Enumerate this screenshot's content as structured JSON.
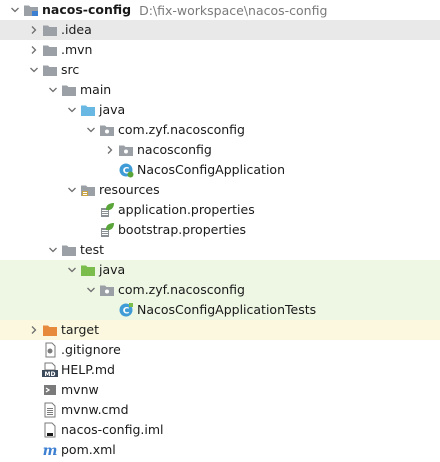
{
  "colors": {
    "folder": "#9aa0a6",
    "folder_source": "#69b8e3",
    "folder_test": "#7bbd4d",
    "folder_excluded": "#e88a3c",
    "resources_badge": "#c9a33f",
    "class_icon": "#3f9cd6",
    "spring_leaf": "#5aa53a",
    "selection_grey": "#e9e9e9",
    "selection_green": "#eef6e4",
    "selection_yellow": "#fbf8df"
  },
  "tree": [
    {
      "label": "nacos-config",
      "path": "D:\\fix-workspace\\nacos-config",
      "level": 0,
      "expander": "down",
      "icon": "module-folder-icon",
      "bold": true
    },
    {
      "label": ".idea",
      "level": 1,
      "expander": "right",
      "icon": "folder-icon",
      "highlight": "grey"
    },
    {
      "label": ".mvn",
      "level": 1,
      "expander": "right",
      "icon": "folder-icon"
    },
    {
      "label": "src",
      "level": 1,
      "expander": "down",
      "icon": "folder-icon"
    },
    {
      "label": "main",
      "level": 2,
      "expander": "down",
      "icon": "folder-icon"
    },
    {
      "label": "java",
      "level": 3,
      "expander": "down",
      "icon": "source-folder-icon"
    },
    {
      "label": "com.zyf.nacosconfig",
      "level": 4,
      "expander": "down",
      "icon": "package-icon"
    },
    {
      "label": "nacosconfig",
      "level": 5,
      "expander": "right",
      "icon": "package-icon"
    },
    {
      "label": "NacosConfigApplication",
      "level": 5,
      "expander": "none",
      "icon": "spring-boot-class-icon"
    },
    {
      "label": "resources",
      "level": 3,
      "expander": "down",
      "icon": "resources-folder-icon"
    },
    {
      "label": "application.properties",
      "level": 4,
      "expander": "none",
      "icon": "spring-properties-icon"
    },
    {
      "label": "bootstrap.properties",
      "level": 4,
      "expander": "none",
      "icon": "spring-properties-icon"
    },
    {
      "label": "test",
      "level": 2,
      "expander": "down",
      "icon": "folder-icon"
    },
    {
      "label": "java",
      "level": 3,
      "expander": "down",
      "icon": "test-folder-icon",
      "highlight": "green"
    },
    {
      "label": "com.zyf.nacosconfig",
      "level": 4,
      "expander": "down",
      "icon": "package-icon",
      "highlight": "green"
    },
    {
      "label": "NacosConfigApplicationTests",
      "level": 5,
      "expander": "none",
      "icon": "test-class-icon",
      "highlight": "green"
    },
    {
      "label": "target",
      "level": 1,
      "expander": "right",
      "icon": "excluded-folder-icon",
      "highlight": "yellow"
    },
    {
      "label": ".gitignore",
      "level": 1,
      "expander": "none",
      "icon": "gitignore-file-icon"
    },
    {
      "label": "HELP.md",
      "level": 1,
      "expander": "none",
      "icon": "markdown-file-icon"
    },
    {
      "label": "mvnw",
      "level": 1,
      "expander": "none",
      "icon": "shell-file-icon"
    },
    {
      "label": "mvnw.cmd",
      "level": 1,
      "expander": "none",
      "icon": "text-file-icon"
    },
    {
      "label": "nacos-config.iml",
      "level": 1,
      "expander": "none",
      "icon": "iml-file-icon"
    },
    {
      "label": "pom.xml",
      "level": 1,
      "expander": "none",
      "icon": "maven-pom-icon"
    }
  ]
}
